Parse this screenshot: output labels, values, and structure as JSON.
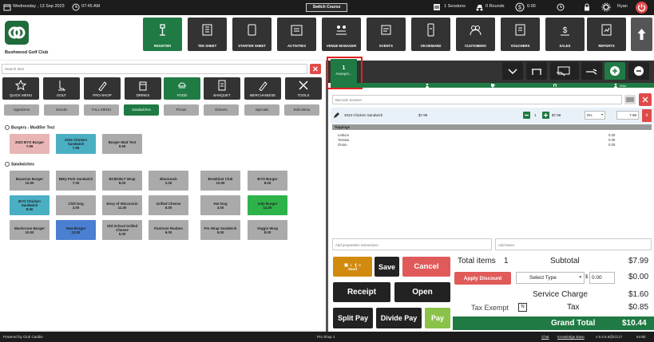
{
  "topbar": {
    "date": "Wednesday , 13 Sep 2023",
    "time": "07:45 AM",
    "switch_course": "Switch Course",
    "sessions": "1 Sessions",
    "rounds": "0 Rounds",
    "amount": "0.00",
    "user": "Ryan"
  },
  "club": {
    "name": "Bushwood Golf Club"
  },
  "nav": [
    {
      "label": "REGISTER",
      "icon": "register-icon"
    },
    {
      "label": "TEE SHEET",
      "icon": "tee-sheet-icon"
    },
    {
      "label": "STARTER SHEET",
      "icon": "starter-sheet-icon"
    },
    {
      "label": "ACTIVITIES",
      "icon": "activities-icon"
    },
    {
      "label": "VENUE MANAGER",
      "icon": "venue-icon"
    },
    {
      "label": "EVENTS",
      "icon": "events-icon"
    },
    {
      "label": "ON DEMAND",
      "icon": "on-demand-icon"
    },
    {
      "label": "CUSTOMERS",
      "icon": "customers-icon"
    },
    {
      "label": "VOUCHERS",
      "icon": "vouchers-icon"
    },
    {
      "label": "SALES",
      "icon": "sales-icon"
    },
    {
      "label": "REPORTS",
      "icon": "reports-icon"
    }
  ],
  "search": {
    "placeholder": "Search Item"
  },
  "categories": [
    {
      "label": "QUICK MENU"
    },
    {
      "label": "GOLF"
    },
    {
      "label": "PRO-SHOP"
    },
    {
      "label": "DRINKS"
    },
    {
      "label": "FOOD"
    },
    {
      "label": "BANQUET"
    },
    {
      "label": "MERCHANDISE"
    },
    {
      "label": "TOOLS"
    }
  ],
  "subcategories": [
    "Appetizers",
    "Snacks",
    "FALL MENU",
    "Sandwiches",
    "Pizzas",
    "Dinners",
    "Specials",
    "Kids Menu"
  ],
  "sections": {
    "burgers": "Burgers - Modifier Test",
    "sandwiches": "Sandwiches"
  },
  "burger_items": [
    {
      "name": "2023 BYO Burger",
      "price": "7.99"
    },
    {
      "name": "2023 Chicken Sandwich",
      "price": "7.99"
    },
    {
      "name": "Burger Mod Test",
      "price": "9.99"
    }
  ],
  "sandwich_items": [
    {
      "name": "Bavarian Burger",
      "price": "10.00"
    },
    {
      "name": "BBQ Pork Sandwich",
      "price": "7.00"
    },
    {
      "name": "BCBCBLT Wrap",
      "price": "8.00"
    },
    {
      "name": "BlackJack",
      "price": "2.00"
    },
    {
      "name": "Breakfast Club",
      "price": "10.00"
    },
    {
      "name": "BYO Burger",
      "price": "8.00"
    },
    {
      "name": "BYO Chicken Sandwich",
      "price": "8.00"
    },
    {
      "name": "Chili Dog",
      "price": "3.00"
    },
    {
      "name": "Envy of Wisconsin",
      "price": "11.00"
    },
    {
      "name": "Grilled Cheese",
      "price": "5.00"
    },
    {
      "name": "Hot Dog",
      "price": "3.00"
    },
    {
      "name": "Indy Burger",
      "price": "14.00"
    },
    {
      "name": "Mushroom Burger",
      "price": "10.00"
    },
    {
      "name": "New Burger",
      "price": "13.00"
    },
    {
      "name": "Old School Grilled Cheese",
      "price": "5.00"
    },
    {
      "name": "Pastrami Reuben",
      "price": "9.00"
    },
    {
      "name": "Pre Wrap Sandwich",
      "price": "5.00"
    },
    {
      "name": "Veggie Wrap",
      "price": "8.00"
    }
  ],
  "customer_tab": {
    "number": "1",
    "name": "Anonym..."
  },
  "order": {
    "head_who": "Who",
    "barcode_placeholder": "Barcode Scanner",
    "line": {
      "name": "2023 Chicken Sandwich",
      "price": "$7.99",
      "qty": "1",
      "line_price": "$7.99",
      "discount": "0%",
      "total": "7.99"
    },
    "toppings_title": "Toppings",
    "toppings": [
      {
        "name": "Lettuce",
        "price": "0.00"
      },
      {
        "name": "Tomato",
        "price": "0.00"
      },
      {
        "name": "Onion",
        "price": "0.00"
      }
    ]
  },
  "notes": {
    "prep": "Add preparation instructions",
    "add": "Add Notes"
  },
  "actions": {
    "send_count": "1",
    "send_zero": "0",
    "send": "Send",
    "save": "Save",
    "cancel": "Cancel",
    "receipt": "Receipt",
    "open": "Open",
    "split": "Split Pay",
    "divide": "Divide Pay",
    "pay": "Pay"
  },
  "totals": {
    "total_items_label": "Total items",
    "total_items": "1",
    "subtotal_label": "Subtotal",
    "subtotal": "$7.99",
    "apply_discount": "Apply Discount",
    "select_type": "Select Type",
    "discount_value": "0.00",
    "discount_amount": "$0.00",
    "service_label": "Service Charge",
    "service": "$1.60",
    "tax_exempt": "Tax Exempt",
    "tax_exempt_value": "N",
    "tax_label": "Tax",
    "tax": "$0.85",
    "grand_label": "Grand Total",
    "grand": "$10.44"
  },
  "footer": {
    "powered": "Powered by Club Caddie",
    "station": "Pro Shop 1",
    "chat": "Chat",
    "kb": "Knowledge Base",
    "version": "v 5.4.6.6@CC17",
    "bits": "64 Bit"
  },
  "colors": {
    "green": "#1f7a43",
    "red": "#e04a4a",
    "dark": "#333333",
    "pink": "#e8b4b4",
    "teal": "#4bafc4",
    "blue": "#4a7fd1",
    "brightgreen": "#2db34a"
  }
}
